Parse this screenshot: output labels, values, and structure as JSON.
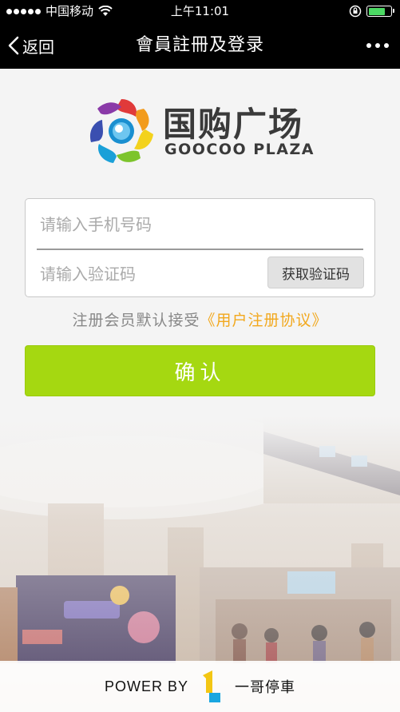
{
  "status_bar": {
    "carrier": "中国移动",
    "time": "上午11:01",
    "battery_level": 0.75,
    "icons": [
      "signal-dots-icon",
      "wifi-icon",
      "rotation-lock-icon",
      "battery-icon"
    ]
  },
  "nav": {
    "back_label": "返回",
    "title": "會員註冊及登录",
    "more_icon": "more-dots-icon"
  },
  "logo": {
    "cn": "国购广场",
    "en": "GOOCOO PLAZA"
  },
  "form": {
    "phone_placeholder": "请输入手机号码",
    "phone_value": "",
    "code_placeholder": "请输入验证码",
    "code_value": "",
    "get_code_label": "获取验证码"
  },
  "agreement": {
    "text": "注册会员默认接受",
    "link": "《用户注册协议》"
  },
  "confirm_label": "确认",
  "footer": {
    "powered_by": "POWER BY",
    "brand": "一哥停車"
  },
  "colors": {
    "accent_green": "#a5d811",
    "link_orange": "#f2a81d",
    "nav_bg": "#000000"
  }
}
